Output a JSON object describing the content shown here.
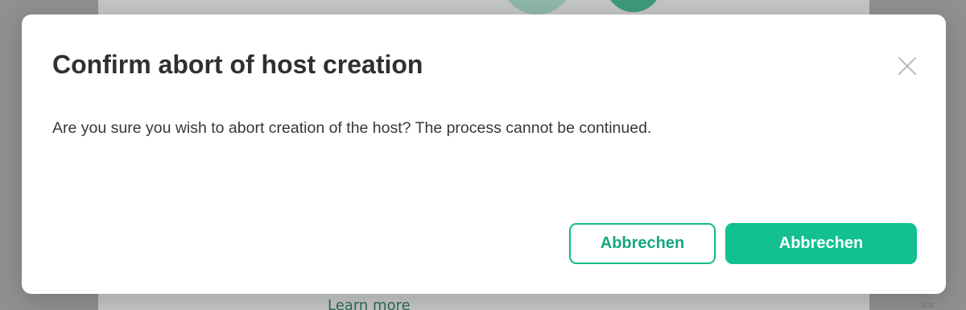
{
  "dialog": {
    "title": "Confirm abort of host creation",
    "message": "Are you sure you wish to abort creation of the host? The process cannot be continued.",
    "close_icon": "close-icon",
    "secondary_button_label": "Abbrechen",
    "primary_button_label": "Abbrechen"
  },
  "background": {
    "link_text": "Learn more"
  },
  "colors": {
    "accent": "#12c18f",
    "title_text": "#2e3033",
    "body_text": "#35383b",
    "overlay": "#8f9091"
  }
}
